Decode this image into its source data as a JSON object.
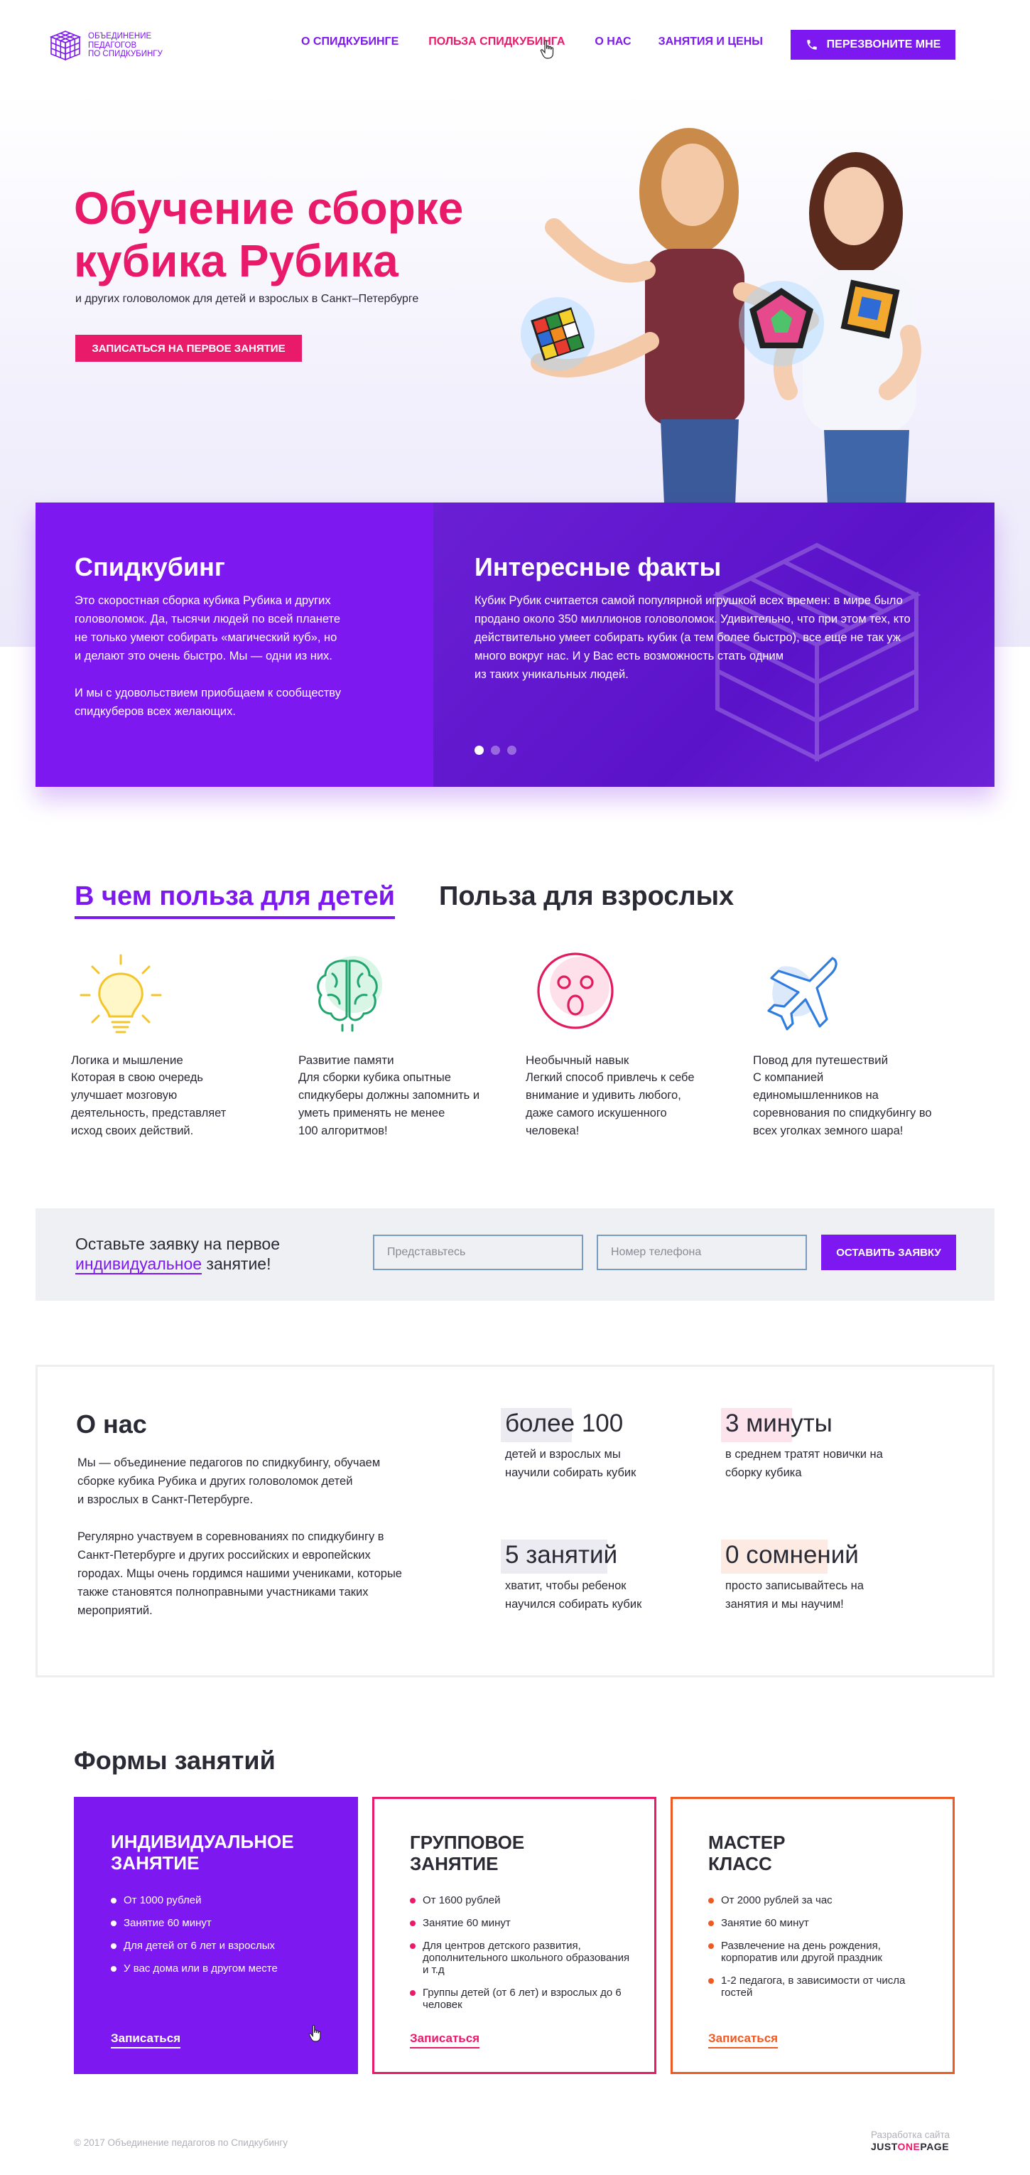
{
  "brand": {
    "logo_lines": [
      "ОБЪЕДИНЕНИЕ",
      "ПЕДАГОГОВ",
      "ПО СПИДКУБИНГУ"
    ]
  },
  "nav": {
    "items": [
      "О спидкубинге",
      "Польза спидкубинга",
      "О нас",
      "Занятия и цены"
    ],
    "active_index": 1,
    "callback_label": "Перезвоните мне"
  },
  "hero": {
    "title_line1": "Обучение сборке",
    "title_line2": "кубика Рубика",
    "subtitle": "и других головоломок для детей и взрослых в Санкт–Петербурге",
    "cta_label": "Записаться на первое занятие"
  },
  "info": {
    "left_title": "Спидкубинг",
    "left_p1": [
      "Это скоростная сборка кубика Рубика и других",
      "головоломок. Да, тысячи людей по всей планете",
      "не только умеют собирать «магический куб», но",
      "и делают это очень быстро. Мы — одни из них."
    ],
    "left_p2": [
      "И мы с удовольствием приобщаем к сообществу",
      "спидкуберов всех желающих."
    ],
    "right_title": "Интересные факты",
    "right_p": [
      "Кубик Рубик считается самой популярной игрушкой всех времен: в мире было",
      "продано около 350 миллионов головоломок. Удивительно, что при этом тех, кто",
      "действительно умеет собирать кубик (а тем более быстро), все еще не так уж",
      "много вокруг нас. И у Вас есть возможность стать одним",
      "из таких уникальных людей."
    ],
    "slides_total": 3,
    "slide_active": 1
  },
  "benefits": {
    "tab_kids": "В чем польза для детей",
    "tab_adults": "Польза для взрослых",
    "items": [
      {
        "icon": "lightbulb-icon",
        "title": "Логика и мышление",
        "lines": [
          "Которая в свою очередь",
          "улучшает мозговую",
          "деятельность, представляет",
          "исход своих действий."
        ]
      },
      {
        "icon": "brain-icon",
        "title": "Развитие памяти",
        "lines": [
          "Для сборки кубика опытные",
          "спидкуберы должны запомнить и",
          "уметь применять не менее",
          "100 алгоритмов!"
        ]
      },
      {
        "icon": "surprised-face-icon",
        "title": "Необычный навык",
        "lines": [
          "Легкий способ привлечь к себе",
          "внимание и удивить любого,",
          "даже самого искушенного",
          "человека!"
        ]
      },
      {
        "icon": "airplane-icon",
        "title": "Повод для путешествий",
        "lines": [
          "С компанией",
          "единомышленников на",
          "соревнования по спидкубингу во",
          "всех уголках земного шара!"
        ]
      }
    ]
  },
  "request": {
    "text_line1": "Оставьте заявку на первое",
    "text_highlight": "индивидуальное",
    "text_tail": " занятие!",
    "name_placeholder": "Представьтесь",
    "phone_placeholder": "Номер телефона",
    "submit_label": "Оставить заявку"
  },
  "about": {
    "title": "О нас",
    "p1": [
      "Мы — объединение педагогов по спидкубингу, обучаем",
      "сборке кубика Рубика и других головоломок детей",
      "и взрослых в Санкт-Петербурге."
    ],
    "p2": [
      "Регулярно участвуем в соревнованиях по спидкубингу в",
      "Санкт-Петербурге и других российских и европейских",
      "городах. Мщы очень гордимся нашими учениками, которые",
      "также становятся полноправными участниками таких",
      "мероприятий."
    ],
    "stats": [
      {
        "value": "более 100",
        "lines": [
          "детей и взрослых мы",
          "научили собирать кубик"
        ],
        "accent": "#ecebf2"
      },
      {
        "value": "3 минуты",
        "lines": [
          "в среднем тратят новички на",
          "сборку кубика"
        ],
        "accent": "#fde3ec"
      },
      {
        "value": "5 занятий",
        "lines": [
          "хватит, чтобы ребенок",
          "научился собирать кубик"
        ],
        "accent": "#ecebf2"
      },
      {
        "value": "0 сомнений",
        "lines": [
          "просто записывайтесь на",
          "занятия и мы научим!"
        ],
        "accent": "#fdebe3"
      }
    ]
  },
  "classes": {
    "title": "Формы занятий",
    "cards": [
      {
        "title_lines": [
          "Индивидуальное",
          "занятие"
        ],
        "items": [
          "От 1000 рублей",
          "Занятие 60 минут",
          "Для детей от 6 лет и взрослых",
          "У вас дома или в другом месте"
        ],
        "link": "Записаться",
        "color": "#7d18f0"
      },
      {
        "title_lines": [
          "Групповое",
          "занятие"
        ],
        "items": [
          "От 1600 рублей",
          "Занятие 60 минут",
          "Для центров детского развития, дополнительного школьного образования и т.д",
          "Группы детей (от 6 лет) и взрослых до 6 человек"
        ],
        "link": "Записаться",
        "color": "#ea1a6b"
      },
      {
        "title_lines": [
          "Мастер",
          "класс"
        ],
        "items": [
          "От 2000 рублей за час",
          "Занятие 60 минут",
          "Развлечение на день рождения, корпоратив или другой праздник",
          "1-2 педагога, в зависимости от числа гостей"
        ],
        "link": "Записаться",
        "color": "#ee5a24"
      }
    ]
  },
  "footer": {
    "copyright": "© 2017  Объединение педагогов по Спидкубингу",
    "dev_label": "Разработка сайта",
    "dev_brand_a": "JUST",
    "dev_brand_b": "ONE",
    "dev_brand_c": "PAGE"
  }
}
